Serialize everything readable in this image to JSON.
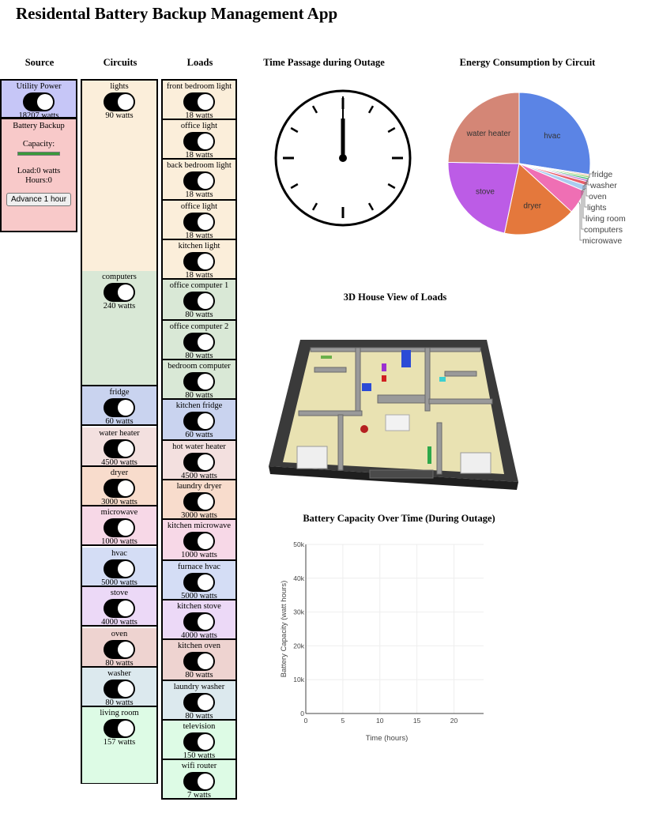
{
  "app": {
    "title": "Residental Battery Backup Management App"
  },
  "headers": {
    "source": "Source",
    "circuits": "Circuits",
    "loads": "Loads"
  },
  "source": {
    "utility": {
      "label": "Utility Power",
      "watts": "18207 watts",
      "on": true,
      "color": "#c6c6f7"
    },
    "battery": {
      "label": "Battery Backup",
      "capacity_label": "Capacity:",
      "load": "Load:0 watts",
      "hours": "Hours:0",
      "advance_label": "Advance 1 hour",
      "color": "#f8c9c9",
      "capacity_bar_color": "#3a9a3a"
    }
  },
  "circuits": [
    {
      "name": "lights",
      "watts": "90 watts",
      "color": "#fbeeda"
    },
    {
      "name": "computers",
      "watts": "240 watts",
      "color": "#d9e8d6"
    },
    {
      "name": "fridge",
      "watts": "60 watts",
      "color": "#c9d3ef"
    },
    {
      "name": "water heater",
      "watts": "4500 watts",
      "color": "#f3e0df"
    },
    {
      "name": "dryer",
      "watts": "3000 watts",
      "color": "#f8dccc"
    },
    {
      "name": "microwave",
      "watts": "1000 watts",
      "color": "#f7d8e7"
    },
    {
      "name": "hvac",
      "watts": "5000 watts",
      "color": "#d4ddf5"
    },
    {
      "name": "stove",
      "watts": "4000 watts",
      "color": "#ecd9f7"
    },
    {
      "name": "oven",
      "watts": "80 watts",
      "color": "#eed3d0"
    },
    {
      "name": "washer",
      "watts": "80 watts",
      "color": "#dce9ee"
    },
    {
      "name": "living room",
      "watts": "157 watts",
      "color": "#ddfbe5"
    }
  ],
  "loads": [
    {
      "name": "front bedroom light",
      "watts": "18 watts",
      "color": "#fbeeda"
    },
    {
      "name": "office light",
      "watts": "18 watts",
      "color": "#fbeeda"
    },
    {
      "name": "back bedroom light",
      "watts": "18 watts",
      "color": "#fbeeda"
    },
    {
      "name": "office light",
      "watts": "18 watts",
      "color": "#fbeeda"
    },
    {
      "name": "kitchen light",
      "watts": "18 watts",
      "color": "#fbeeda"
    },
    {
      "name": "office computer 1",
      "watts": "80 watts",
      "color": "#d9e8d6"
    },
    {
      "name": "office computer 2",
      "watts": "80 watts",
      "color": "#d9e8d6"
    },
    {
      "name": "bedroom computer",
      "watts": "80 watts",
      "color": "#d9e8d6"
    },
    {
      "name": "kitchen fridge",
      "watts": "60 watts",
      "color": "#c9d3ef"
    },
    {
      "name": "hot water heater",
      "watts": "4500 watts",
      "color": "#f3e0df"
    },
    {
      "name": "laundry dryer",
      "watts": "3000 watts",
      "color": "#f8dccc"
    },
    {
      "name": "kitchen microwave",
      "watts": "1000 watts",
      "color": "#f7d8e7"
    },
    {
      "name": "furnace hvac",
      "watts": "5000 watts",
      "color": "#d4ddf5"
    },
    {
      "name": "kitchen stove",
      "watts": "4000 watts",
      "color": "#ecd9f7"
    },
    {
      "name": "kitchen oven",
      "watts": "80 watts",
      "color": "#eed3d0"
    },
    {
      "name": "laundry washer",
      "watts": "80 watts",
      "color": "#dce9ee"
    },
    {
      "name": "television",
      "watts": "150 watts",
      "color": "#ddfbe5"
    },
    {
      "name": "wifi router",
      "watts": "7 watts",
      "color": "#ddfbe5"
    }
  ],
  "clock": {
    "title": "Time Passage during Outage"
  },
  "house": {
    "title": "3D House View of Loads"
  },
  "chart_data": [
    {
      "type": "pie",
      "title": "Energy Consumption by Circuit",
      "labels": [
        "hvac",
        "fridge",
        "washer",
        "oven",
        "lights",
        "living room",
        "computers",
        "microwave",
        "dryer",
        "stove",
        "water heater"
      ],
      "values": [
        5000,
        60,
        80,
        80,
        90,
        157,
        240,
        1000,
        3000,
        4000,
        4500
      ],
      "colors": [
        "#5b84e5",
        "#f4a582",
        "#93d36a",
        "#3cb371",
        "#c47bd8",
        "#e85d6a",
        "#aaccf0",
        "#ef6fb4",
        "#e4783c",
        "#bc5ce6",
        "#d48676"
      ],
      "inside_labels": [
        "hvac",
        "dryer",
        "stove",
        "water heater"
      ],
      "outside_labels": [
        "fridge",
        "washer",
        "oven",
        "lights",
        "living room",
        "computers",
        "microwave"
      ]
    },
    {
      "type": "line",
      "title": "Battery Capacity Over Time (During Outage)",
      "xlabel": "Time (hours)",
      "ylabel": "Battery Capacity (watt hours)",
      "xlim": [
        0,
        24
      ],
      "ylim": [
        0,
        50000
      ],
      "xticks": [
        "0",
        "5",
        "10",
        "15",
        "20"
      ],
      "yticks": [
        "0",
        "10k",
        "20k",
        "30k",
        "40k",
        "50k"
      ],
      "series": []
    }
  ]
}
